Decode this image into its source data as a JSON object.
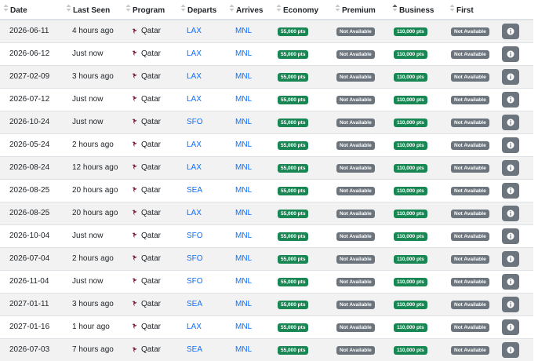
{
  "headers": {
    "date": "Date",
    "last_seen": "Last Seen",
    "program": "Program",
    "departs": "Departs",
    "arrives": "Arrives",
    "economy": "Economy",
    "premium": "Premium",
    "business": "Business",
    "first": "First"
  },
  "sort": {
    "active_column": "business",
    "direction": "ascending"
  },
  "colors": {
    "points_badge": "#198754",
    "unavailable_badge": "#6c757d",
    "link": "#0d6efd",
    "info_button": "#6c757d"
  },
  "icons": {
    "sort": "sort-icon",
    "airline": "qatar-airways-logo-icon",
    "info": "info-icon"
  },
  "rows": [
    {
      "date": "2026-06-11",
      "last_seen": "4 hours ago",
      "program": "Qatar",
      "departs": "LAX",
      "arrives": "MNL",
      "economy": "55,000 pts",
      "premium": "Not Available",
      "business": "110,000 pts",
      "first": "Not Available"
    },
    {
      "date": "2026-06-12",
      "last_seen": "Just now",
      "program": "Qatar",
      "departs": "LAX",
      "arrives": "MNL",
      "economy": "55,000 pts",
      "premium": "Not Available",
      "business": "110,000 pts",
      "first": "Not Available"
    },
    {
      "date": "2027-02-09",
      "last_seen": "3 hours ago",
      "program": "Qatar",
      "departs": "LAX",
      "arrives": "MNL",
      "economy": "55,000 pts",
      "premium": "Not Available",
      "business": "110,000 pts",
      "first": "Not Available"
    },
    {
      "date": "2026-07-12",
      "last_seen": "Just now",
      "program": "Qatar",
      "departs": "LAX",
      "arrives": "MNL",
      "economy": "55,000 pts",
      "premium": "Not Available",
      "business": "110,000 pts",
      "first": "Not Available"
    },
    {
      "date": "2026-10-24",
      "last_seen": "Just now",
      "program": "Qatar",
      "departs": "SFO",
      "arrives": "MNL",
      "economy": "55,000 pts",
      "premium": "Not Available",
      "business": "110,000 pts",
      "first": "Not Available"
    },
    {
      "date": "2026-05-24",
      "last_seen": "2 hours ago",
      "program": "Qatar",
      "departs": "LAX",
      "arrives": "MNL",
      "economy": "55,000 pts",
      "premium": "Not Available",
      "business": "110,000 pts",
      "first": "Not Available"
    },
    {
      "date": "2026-08-24",
      "last_seen": "12 hours ago",
      "program": "Qatar",
      "departs": "LAX",
      "arrives": "MNL",
      "economy": "55,000 pts",
      "premium": "Not Available",
      "business": "110,000 pts",
      "first": "Not Available"
    },
    {
      "date": "2026-08-25",
      "last_seen": "20 hours ago",
      "program": "Qatar",
      "departs": "SEA",
      "arrives": "MNL",
      "economy": "55,000 pts",
      "premium": "Not Available",
      "business": "110,000 pts",
      "first": "Not Available"
    },
    {
      "date": "2026-08-25",
      "last_seen": "20 hours ago",
      "program": "Qatar",
      "departs": "LAX",
      "arrives": "MNL",
      "economy": "55,000 pts",
      "premium": "Not Available",
      "business": "110,000 pts",
      "first": "Not Available"
    },
    {
      "date": "2026-10-04",
      "last_seen": "Just now",
      "program": "Qatar",
      "departs": "SFO",
      "arrives": "MNL",
      "economy": "55,000 pts",
      "premium": "Not Available",
      "business": "110,000 pts",
      "first": "Not Available"
    },
    {
      "date": "2026-07-04",
      "last_seen": "2 hours ago",
      "program": "Qatar",
      "departs": "SFO",
      "arrives": "MNL",
      "economy": "55,000 pts",
      "premium": "Not Available",
      "business": "110,000 pts",
      "first": "Not Available"
    },
    {
      "date": "2026-11-04",
      "last_seen": "Just now",
      "program": "Qatar",
      "departs": "SFO",
      "arrives": "MNL",
      "economy": "55,000 pts",
      "premium": "Not Available",
      "business": "110,000 pts",
      "first": "Not Available"
    },
    {
      "date": "2027-01-11",
      "last_seen": "3 hours ago",
      "program": "Qatar",
      "departs": "SEA",
      "arrives": "MNL",
      "economy": "55,000 pts",
      "premium": "Not Available",
      "business": "110,000 pts",
      "first": "Not Available"
    },
    {
      "date": "2027-01-16",
      "last_seen": "1 hour ago",
      "program": "Qatar",
      "departs": "LAX",
      "arrives": "MNL",
      "economy": "55,000 pts",
      "premium": "Not Available",
      "business": "110,000 pts",
      "first": "Not Available"
    },
    {
      "date": "2026-07-03",
      "last_seen": "7 hours ago",
      "program": "Qatar",
      "departs": "SEA",
      "arrives": "MNL",
      "economy": "55,000 pts",
      "premium": "Not Available",
      "business": "110,000 pts",
      "first": "Not Available"
    }
  ]
}
